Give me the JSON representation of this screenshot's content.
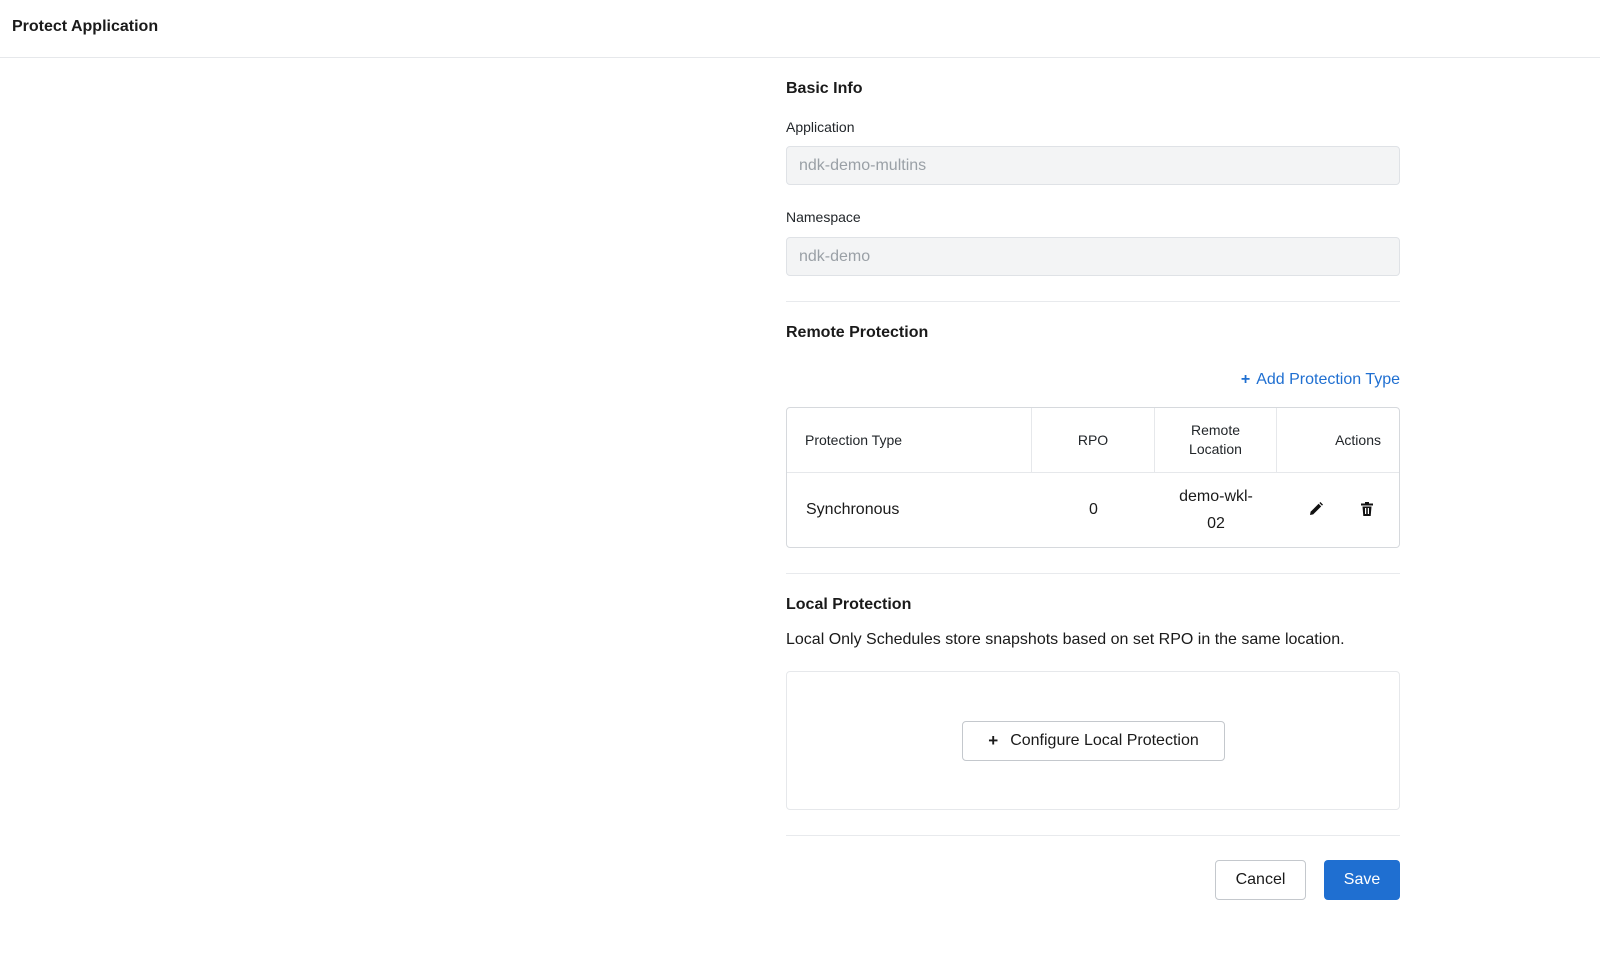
{
  "header": {
    "title": "Protect Application"
  },
  "basic_info": {
    "title": "Basic Info",
    "application": {
      "label": "Application",
      "value": "ndk-demo-multins"
    },
    "namespace": {
      "label": "Namespace",
      "value": "ndk-demo"
    }
  },
  "remote_protection": {
    "title": "Remote Protection",
    "add_label": "Add Protection Type",
    "columns": [
      "Protection Type",
      "RPO",
      "Remote\nLocation",
      "Actions"
    ],
    "rows": [
      {
        "protection_type": "Synchronous",
        "rpo": "0",
        "remote_location": "demo-wkl-\n02"
      }
    ]
  },
  "local_protection": {
    "title": "Local Protection",
    "description": "Local Only Schedules store snapshots based on set RPO in the same location.",
    "configure_label": "Configure Local Protection"
  },
  "footer": {
    "cancel_label": "Cancel",
    "save_label": "Save"
  },
  "colors": {
    "accent": "#1f6fd1",
    "input_bg": "#f3f4f5",
    "border": "#d6d9dd"
  },
  "icons": {
    "add": "plus-icon",
    "edit": "pencil-icon",
    "delete": "trash-icon"
  }
}
